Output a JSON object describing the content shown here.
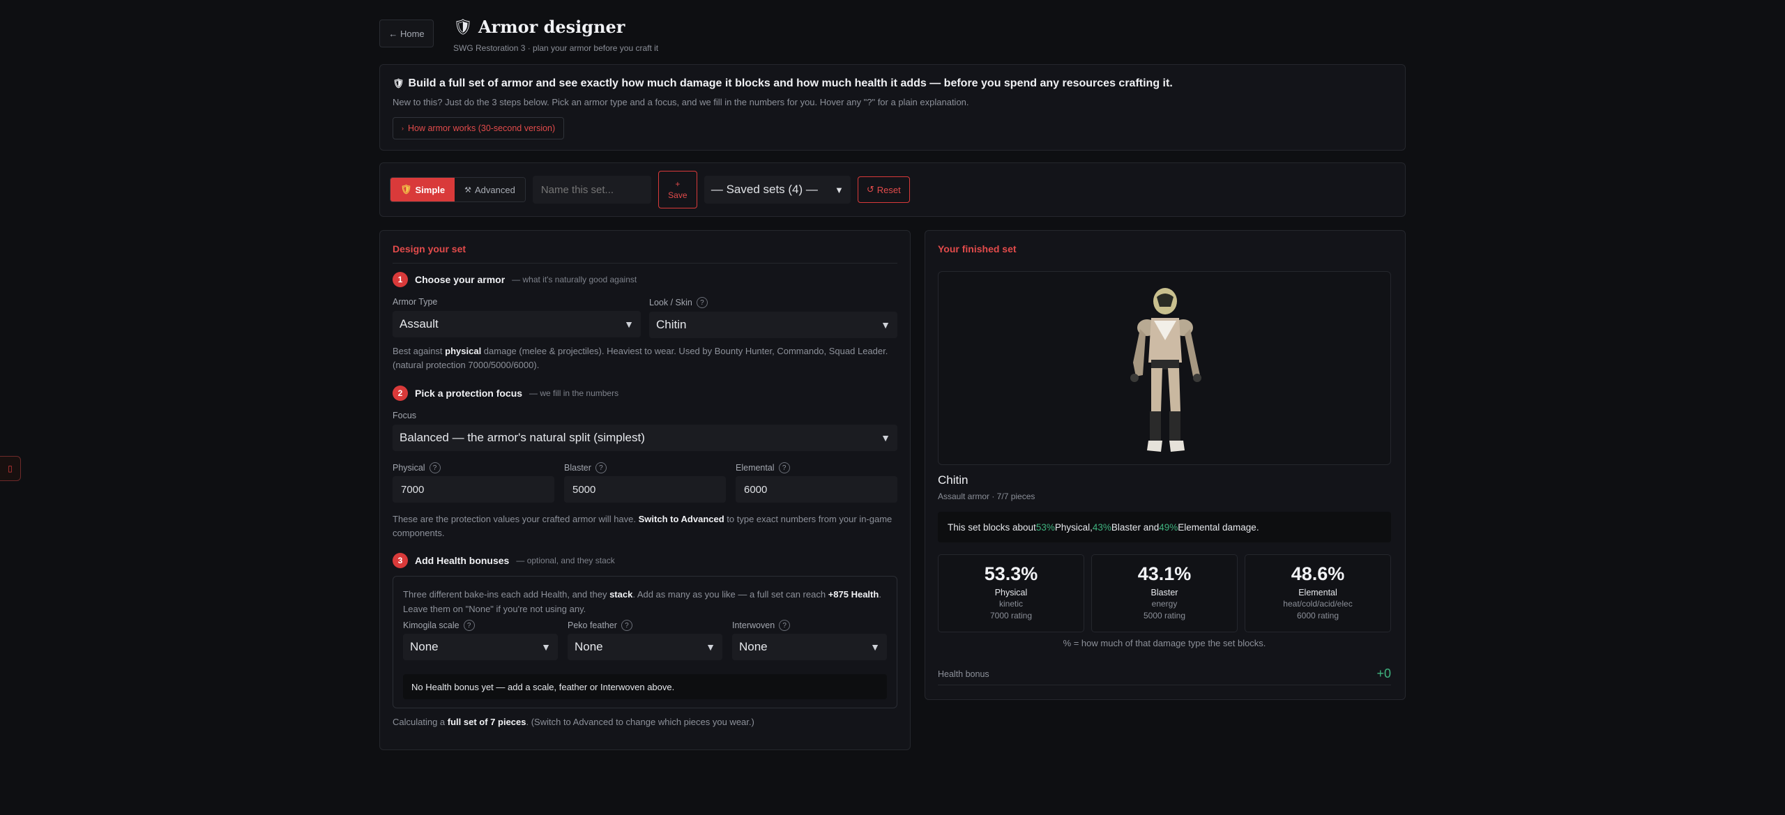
{
  "header": {
    "home_label": "← Home",
    "title": "Armor designer",
    "subtitle": "SWG Restoration 3 · plan your armor before you craft it"
  },
  "intro": {
    "headline": "Build a full set of armor and see exactly how much damage it blocks and how much health it adds — before you spend any resources crafting it.",
    "sub": "New to this? Just do the 3 steps below. Pick an armor type and a focus, and we fill in the numbers for you. Hover any \"?\" for a plain explanation.",
    "how_link": "How armor works (30-second version)"
  },
  "toolbar": {
    "mode_simple": "Simple",
    "mode_advanced": "Advanced",
    "name_placeholder": "Name this set...",
    "save_plus": "+",
    "save_label": "Save",
    "saved_sets": "— Saved sets (4) —",
    "reset_label": "Reset"
  },
  "design": {
    "title": "Design your set",
    "step1": {
      "num": "1",
      "label": "Choose your armor",
      "hint": "— what it's naturally good against"
    },
    "armor_type_label": "Armor Type",
    "armor_type_value": "Assault",
    "look_label": "Look / Skin",
    "look_value": "Chitin",
    "armor_desc_pre": "Best against ",
    "armor_desc_bold": "physical",
    "armor_desc_post": " damage (melee & projectiles). Heaviest to wear. Used by Bounty Hunter, Commando, Squad Leader. (natural protection 7000/5000/6000).",
    "step2": {
      "num": "2",
      "label": "Pick a protection focus",
      "hint": "— we fill in the numbers"
    },
    "focus_label": "Focus",
    "focus_value": "Balanced — the armor's natural split (simplest)",
    "physical_label": "Physical",
    "physical_value": "7000",
    "blaster_label": "Blaster",
    "blaster_value": "5000",
    "elemental_label": "Elemental",
    "elemental_value": "6000",
    "values_desc_pre": "These are the protection values your crafted armor will have. ",
    "values_desc_bold": "Switch to Advanced",
    "values_desc_post": " to type exact numbers from your in-game components.",
    "step3": {
      "num": "3",
      "label": "Add Health bonuses",
      "hint": "— optional, and they stack"
    },
    "health_desc_1": "Three different bake-ins each add Health, and they ",
    "health_desc_stack": "stack",
    "health_desc_2": ". Add as many as you like — a full set can reach ",
    "health_desc_max": "+875 Health",
    "health_desc_3": ". Leave them on \"None\" if you're not using any.",
    "kimogila_label": "Kimogila scale",
    "kimogila_value": "None",
    "peko_label": "Peko feather",
    "peko_value": "None",
    "interwoven_label": "Interwoven",
    "interwoven_value": "None",
    "health_notice": "No Health bonus yet — add a scale, feather or Interwoven above.",
    "calc_pre": "Calculating a ",
    "calc_bold": "full set of 7 pieces",
    "calc_post": ". (Switch to Advanced to change which pieces you wear.)"
  },
  "result": {
    "title": "Your finished set",
    "set_name": "Chitin",
    "set_meta": "Assault armor · 7/7 pieces",
    "summary_pre": "This set blocks about ",
    "summary_phys": "53%",
    "summary_mid1": " Physical, ",
    "summary_blast": "43%",
    "summary_mid2": " Blaster and ",
    "summary_elem": "49%",
    "summary_post": " Elemental damage.",
    "stats": [
      {
        "pct": "53.3%",
        "name": "Physical",
        "sub": "kinetic",
        "rating": "7000 rating"
      },
      {
        "pct": "43.1%",
        "name": "Blaster",
        "sub": "energy",
        "rating": "5000 rating"
      },
      {
        "pct": "48.6%",
        "name": "Elemental",
        "sub": "heat/cold/acid/elec",
        "rating": "6000 rating"
      }
    ],
    "stat_note": "% = how much of that damage type the set blocks.",
    "health_label": "Health bonus",
    "health_value": "+0"
  },
  "colors": {
    "accent": "#d93a3a",
    "positive": "#3fb37f",
    "background": "#0e0f12",
    "panel": "#131419"
  },
  "icons": {
    "title": "shield-icon",
    "mode_simple": "shield-icon",
    "mode_advanced": "tools-icon",
    "reset": "reset-icon",
    "help": "question-icon",
    "side_tab": "mouse-icon"
  }
}
